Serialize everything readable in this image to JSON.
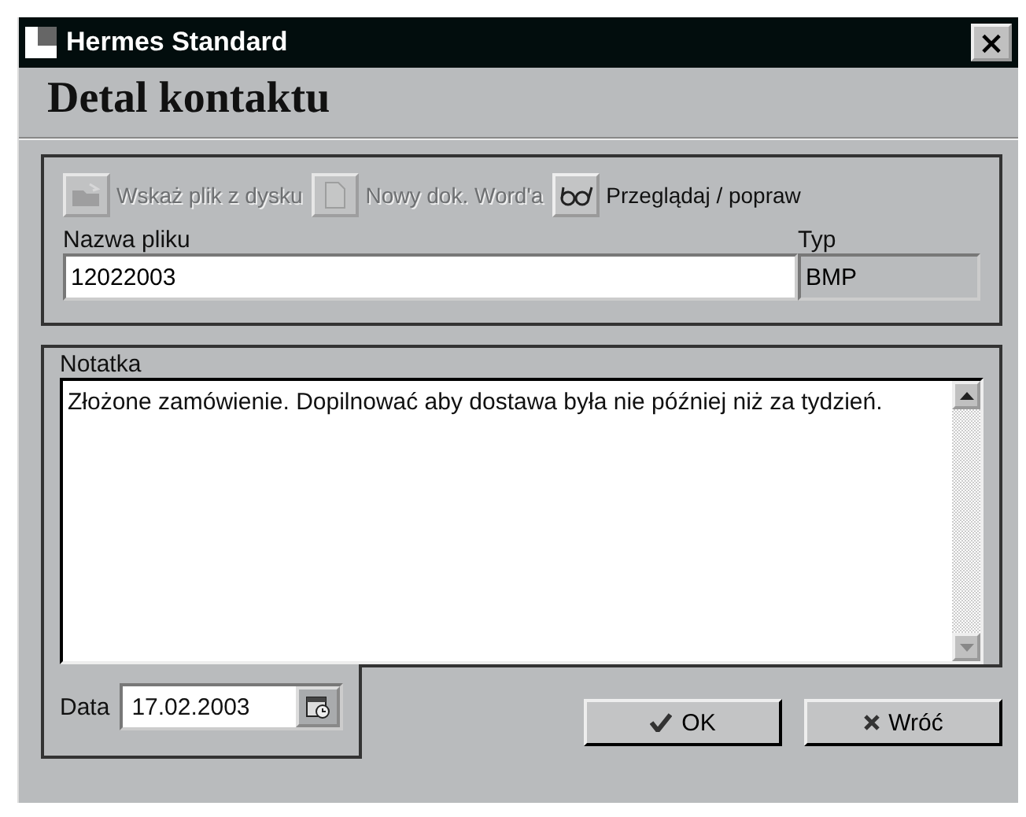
{
  "window": {
    "title": "Hermes Standard",
    "close": "×"
  },
  "heading": "Detal kontaktu",
  "toolbar": [
    {
      "kind": "folder",
      "label": "Wskaż plik z dysku",
      "disabled": true
    },
    {
      "kind": "document",
      "label": "Nowy dok. Word'a",
      "disabled": true
    },
    {
      "kind": "glasses",
      "label": "Przeglądaj / popraw",
      "disabled": false
    }
  ],
  "file": {
    "name_label": "Nazwa pliku",
    "name_value": "12022003",
    "type_label": "Typ",
    "type_value": "BMP"
  },
  "note": {
    "label": "Notatka",
    "value": "Złożone zamówienie. Dopilnować aby dostawa była nie później niż za tydzień."
  },
  "date": {
    "label": "Data",
    "value": "17.02.2003"
  },
  "buttons": [
    {
      "kind": "ok",
      "label": "OK"
    },
    {
      "kind": "cancel",
      "label": "Wróć"
    }
  ]
}
